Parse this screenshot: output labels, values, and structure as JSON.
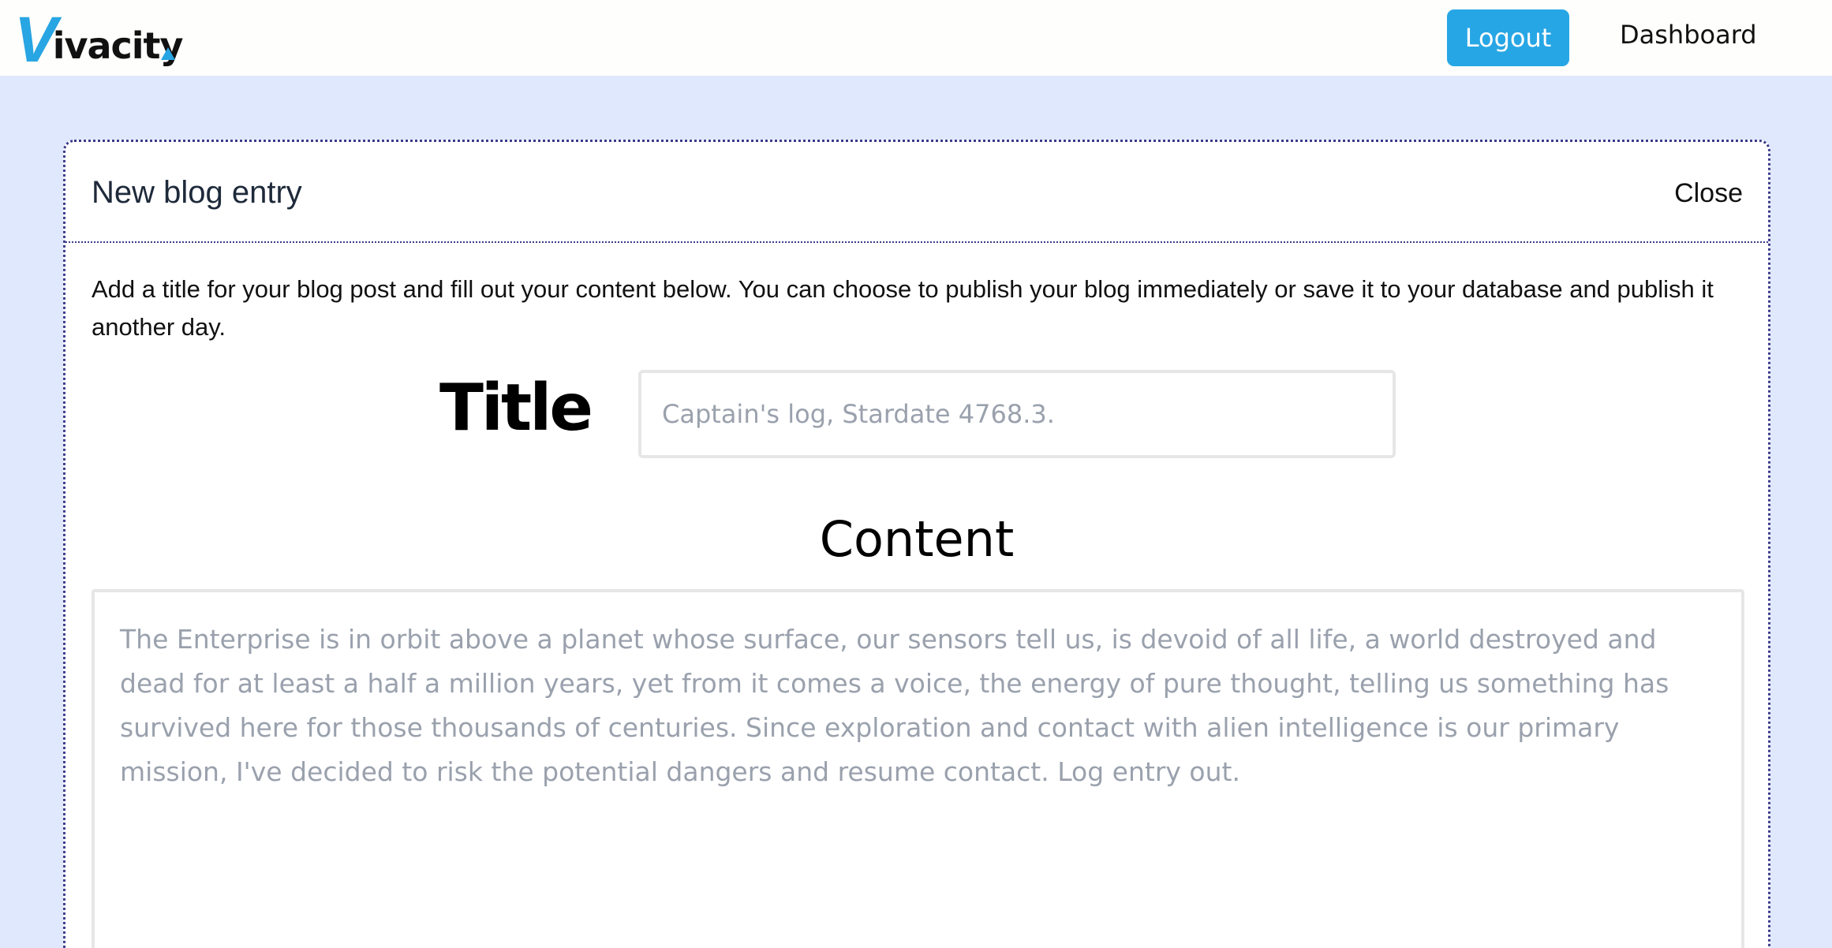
{
  "brand": {
    "logo_initial": "V",
    "logo_rest": "ivacity",
    "accent_color": "#28a5e3"
  },
  "nav": {
    "logout_label": "Logout",
    "dashboard_label": "Dashboard"
  },
  "modal": {
    "title": "New blog entry",
    "close_label": "Close",
    "intro": "Add a title for your blog post and fill out your content below. You can choose to publish your blog immediately or save it to your database and publish it another day.",
    "title_label": "Title",
    "title_input": {
      "value": "",
      "placeholder": "Captain's log, Stardate 4768.3."
    },
    "content_heading": "Content",
    "content_input": {
      "value": "",
      "placeholder": "The Enterprise is in orbit above a planet whose surface, our sensors tell us, is devoid of all life, a world destroyed and dead for at least a half a million years, yet from it comes a voice, the energy of pure thought, telling us something has survived here for those thousands of centuries. Since exploration and contact with alien intelligence is our primary mission, I've decided to risk the potential dangers and resume contact. Log entry out."
    }
  }
}
